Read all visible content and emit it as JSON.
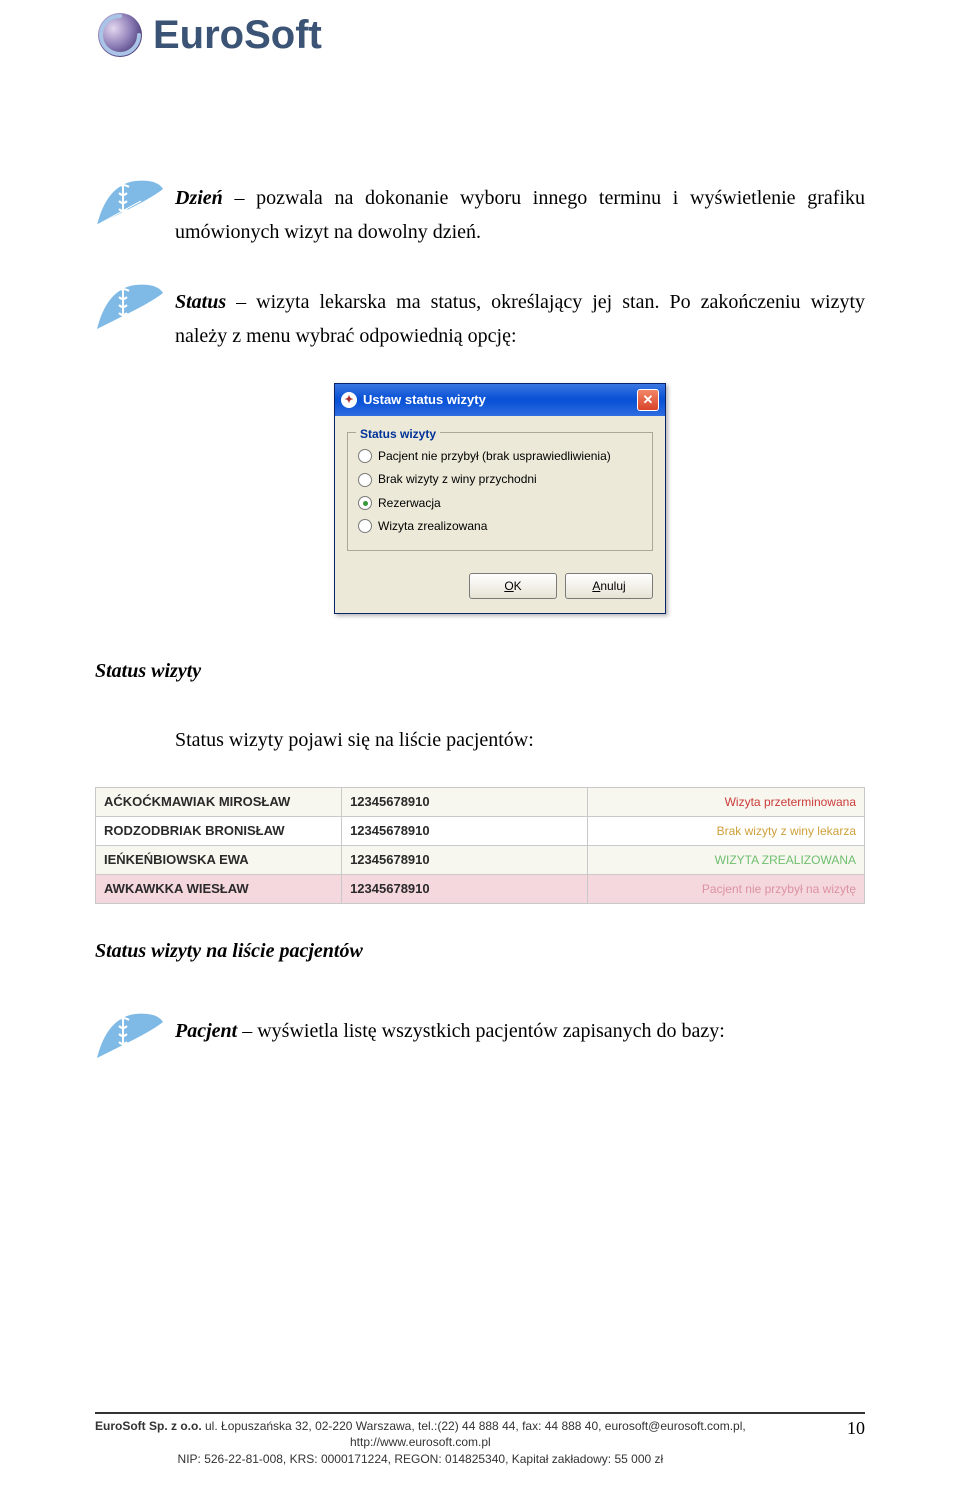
{
  "header": {
    "brand": "EuroSoft"
  },
  "para1": {
    "term": "Dzień",
    "rest": " – pozwala na dokonanie wyboru innego terminu i wyświetlenie grafiku umówionych wizyt na dowolny dzień."
  },
  "para2": {
    "term": "Status",
    "rest": " – wizyta lekarska ma status, określający jej stan. Po zakończeniu wizyty należy z menu wybrać odpowiednią opcję:"
  },
  "dialog": {
    "title": "Ustaw status wizyty",
    "legend": "Status wizyty",
    "options": [
      "Pacjent nie przybył (brak usprawiedliwienia)",
      "Brak wizyty z winy przychodni",
      "Rezerwacja",
      "Wizyta zrealizowana"
    ],
    "selected_index": 2,
    "ok_key": "O",
    "ok_label": "K",
    "cancel_key": "A",
    "cancel_label": "nuluj"
  },
  "caption_status_wizyty": "Status wizyty",
  "desc_status_list": "Status wizyty pojawi się na liście pacjentów:",
  "patients": [
    {
      "name": "AĆKOĆKMAWIAK MIROSŁAW",
      "pesel": "12345678910",
      "status": "Wizyta przeterminowana",
      "cls": "st-red"
    },
    {
      "name": "RODZODBRIAK BRONISŁAW",
      "pesel": "12345678910",
      "status": "Brak wizyty z winy lekarza",
      "cls": "st-orange"
    },
    {
      "name": "IEŃKEŃBIOWSKA EWA",
      "pesel": "12345678910",
      "status": "WIZYTA ZREALIZOWANA",
      "cls": "st-green"
    },
    {
      "name": "AWKAWKKA WIESŁAW",
      "pesel": "12345678910",
      "status": "Pacjent nie przybył na wizytę",
      "cls": "st-pink-text",
      "rowcls": "st-pink-bg"
    }
  ],
  "caption_status_list": "Status wizyty na liście pacjentów",
  "para3": {
    "term": "Pacjent",
    "rest": " – wyświetla listę wszystkich pacjentów zapisanych do bazy:"
  },
  "footer": {
    "line1a": "EuroSoft Sp. z o.o.",
    "line1b": " ul. Łopuszańska 32, 02-220 Warszawa, tel.:(22) 44 888 44, fax: 44 888 40, eurosoft@eurosoft.com.pl,",
    "line2": "http://www.eurosoft.com.pl",
    "line3": "NIP: 526-22-81-008, KRS: 0000171224, REGON: 014825340, Kapitał zakładowy: 55 000 zł",
    "page": "10"
  }
}
